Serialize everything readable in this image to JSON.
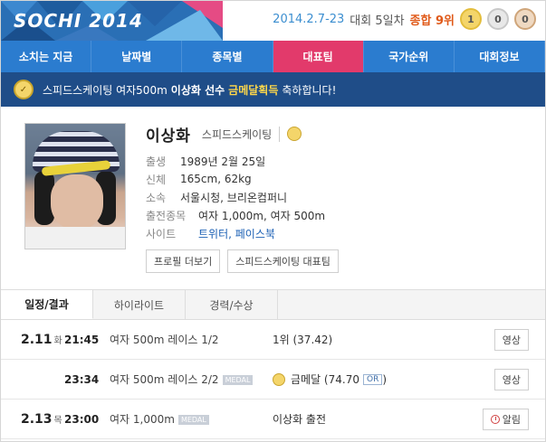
{
  "header": {
    "logo_text": "SOCHI 2014",
    "date_range": "2014.2.7-23",
    "day_text": "대회 5일차",
    "rank_text": "종합 9위",
    "medals": {
      "gold": "1",
      "silver": "0",
      "bronze": "0"
    }
  },
  "nav": {
    "items": [
      "소치는 지금",
      "날짜별",
      "종목별",
      "대표팀",
      "국가순위",
      "대회정보"
    ],
    "active_index": 3
  },
  "banner": {
    "prefix": "스피드스케이팅 여자500m",
    "name": "이상화 선수",
    "medal": "금메달획득",
    "suffix": "축하합니다!"
  },
  "profile": {
    "name": "이상화",
    "sport": "스피드스케이팅",
    "details": [
      {
        "label": "출생",
        "value": "1989년 2월 25일"
      },
      {
        "label": "신체",
        "value": "165cm, 62kg"
      },
      {
        "label": "소속",
        "value": "서울시청, 브리온컴퍼니"
      },
      {
        "label": "출전종목",
        "value": "여자 1,000m, 여자 500m"
      },
      {
        "label": "사이트",
        "value": "트위터, 페이스북"
      }
    ],
    "buttons": [
      "프로필 더보기",
      "스피드스케이팅 대표팀"
    ]
  },
  "tabs": [
    "일정/결과",
    "하이라이트",
    "경력/수상"
  ],
  "schedule": [
    {
      "date": "2.11",
      "dow": "화",
      "time": "21:45",
      "event": "여자 500m 레이스 1/2",
      "tag": "",
      "result": "1위 (37.42)",
      "medal": false,
      "or": "",
      "action": "영상"
    },
    {
      "date": "",
      "dow": "",
      "time": "23:34",
      "event": "여자 500m 레이스 2/2",
      "tag": "MEDAL",
      "result": "금메달 (74.70",
      "medal": true,
      "or": "OR",
      "action": "영상"
    },
    {
      "date": "2.13",
      "dow": "목",
      "time": "23:00",
      "event": "여자 1,000m",
      "tag": "MEDAL",
      "result": "이상화 출전",
      "medal": false,
      "or": "",
      "action": "알림"
    }
  ]
}
